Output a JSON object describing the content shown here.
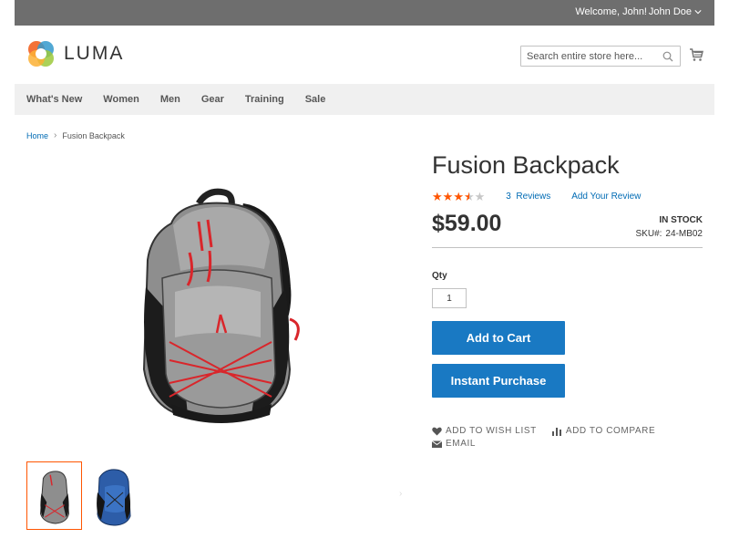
{
  "topbar": {
    "welcome": "Welcome, John!",
    "user_name": "John Doe"
  },
  "header": {
    "logo_text": "LUMA",
    "search_placeholder": "Search entire store here..."
  },
  "nav": {
    "items": [
      "What's New",
      "Women",
      "Men",
      "Gear",
      "Training",
      "Sale"
    ]
  },
  "breadcrumb": {
    "home": "Home",
    "current": "Fusion Backpack"
  },
  "product": {
    "title": "Fusion Backpack",
    "rating_stars": 3.5,
    "rating_max": 5,
    "reviews_count": "3",
    "reviews_label": "Reviews",
    "add_review": "Add Your Review",
    "price": "$59.00",
    "stock": "IN STOCK",
    "sku_label": "SKU#:",
    "sku_value": "24-MB02",
    "qty_label": "Qty",
    "qty_value": "1",
    "add_to_cart": "Add to Cart",
    "instant_purchase": "Instant Purchase",
    "wishlist": "ADD TO WISH LIST",
    "compare": "ADD TO COMPARE",
    "email": "EMAIL"
  },
  "gallery": {
    "gallery_next": "›"
  },
  "colors": {
    "accent_blue": "#1979c3",
    "link_blue": "#006bb4",
    "star_orange": "#ff5501",
    "thumb_active_border": "#ff5501",
    "topbar_bg": "#6e6e6e",
    "nav_bg": "#f0f0f0"
  },
  "icons": {
    "cart": "cart-icon",
    "search": "search-icon",
    "wishlist": "heart-icon",
    "compare": "compare-icon",
    "email": "envelope-icon"
  }
}
